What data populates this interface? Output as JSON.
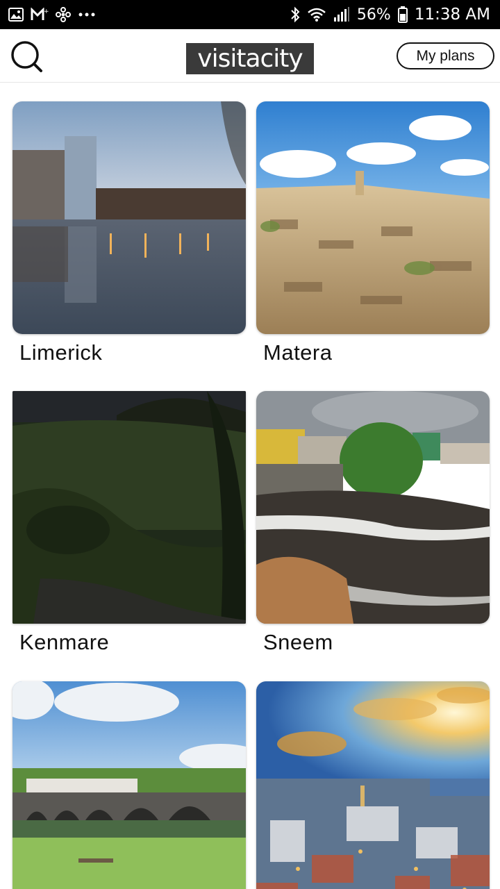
{
  "status_bar": {
    "icons_left": [
      "gallery-icon",
      "gmail-icon",
      "pinwheel-icon",
      "more-dots-icon"
    ],
    "icons_right": [
      "bluetooth-icon",
      "wifi-icon",
      "signal-icon",
      "battery-icon"
    ],
    "battery": "56%",
    "time": "11:38 AM"
  },
  "header": {
    "search_icon": "search-icon",
    "logo": "visitacity",
    "plans_button": "My plans"
  },
  "cities": [
    {
      "name": "Limerick",
      "image": "city skyline at dusk reflected in river"
    },
    {
      "name": "Matera",
      "image": "ancient stone town on hillside under blue sky"
    },
    {
      "name": "Kenmare",
      "image": "dark green hillside with path"
    },
    {
      "name": "Sneem",
      "image": "rocky river rapids with village houses"
    },
    {
      "name": "",
      "image": "stone arched bridge over river with green lawn"
    },
    {
      "name": "",
      "image": "aerial city view with sunburst sky"
    }
  ],
  "colors": {
    "status_bar": "#000000",
    "background": "#ffffff",
    "logo_bg": "#3a3a3a",
    "text": "#111111"
  }
}
